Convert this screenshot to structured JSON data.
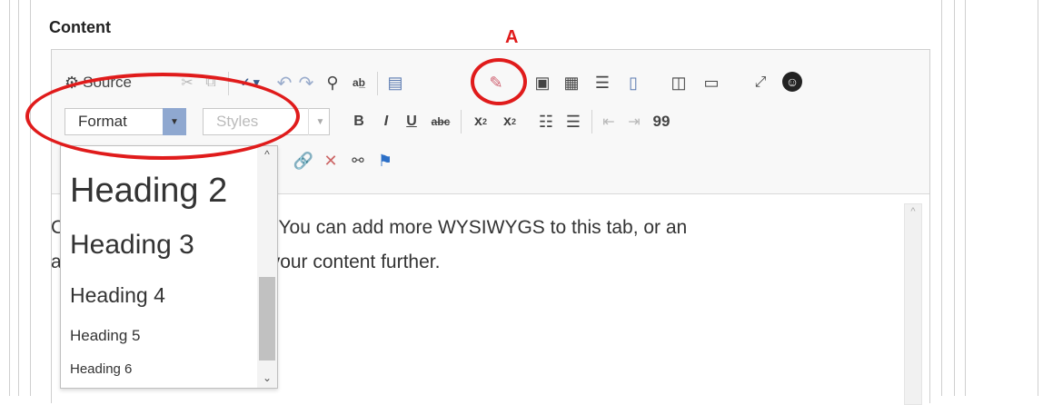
{
  "section": {
    "label": "Content"
  },
  "toolbar": {
    "source_label": "Source",
    "format_label": "Format",
    "styles_label": "Styles",
    "buttons": {
      "bold": "B",
      "italic": "I",
      "underline": "U",
      "strike": "abc",
      "subscript": "x",
      "superscript": "x",
      "blockquote": "99"
    },
    "icons": [
      "source-icon",
      "cut-icon",
      "copy-icon",
      "spellcheck-icon",
      "undo-icon",
      "redo-icon",
      "find-icon",
      "replace-icon",
      "select-all-icon",
      "remove-format-icon",
      "image-icon",
      "table-icon",
      "horizontal-rule-icon",
      "iframe-icon",
      "showblocks-icon",
      "template-icon",
      "maximize-icon",
      "accessibility-icon",
      "link-icon",
      "unlink-icon",
      "anchor-icon",
      "flag-icon"
    ]
  },
  "format_dropdown": {
    "items": [
      "Heading 2",
      "Heading 3",
      "Heading 4",
      "Heading 5",
      "Heading 6"
    ]
  },
  "content": {
    "line1_prefix": "C",
    "line1_text": ". You can add more WYSIWYGS to this tab, or an",
    "line2_prefix": "a",
    "line2_text": "your content further."
  },
  "annotation": {
    "label": "A",
    "color": "#e01b1b"
  }
}
